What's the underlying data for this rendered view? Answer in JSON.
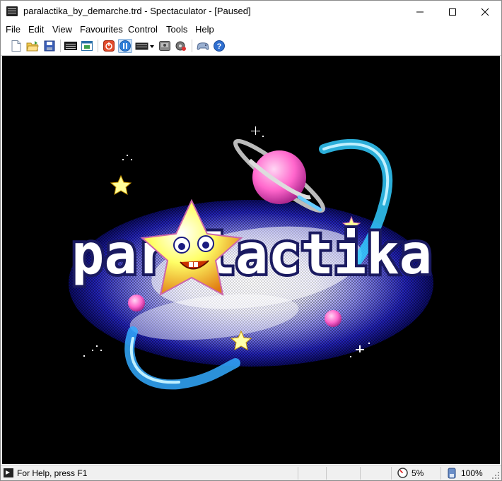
{
  "window": {
    "title": "paralactika_by_demarche.trd - Spectaculator - [Paused]",
    "minimize_icon": "minimize-icon",
    "maximize_icon": "maximize-icon",
    "close_icon": "close-icon"
  },
  "menu": [
    "File",
    "Edit",
    "View",
    "Favourites",
    "Control",
    "Tools",
    "Help"
  ],
  "toolbar": {
    "buttons": [
      "new-icon",
      "open-icon",
      "save-icon",
      "keyboard-icon",
      "window-icon",
      "power-icon",
      "pause-icon",
      "joystick-keyboard-icon",
      "disk-icon",
      "tape-icon",
      "controller-icon",
      "help-icon"
    ]
  },
  "screen": {
    "logo_text": "paralactika",
    "colors": {
      "background": "#000000",
      "galaxy_inner": "#e8e8ff",
      "galaxy_outer": "#1a1aa8",
      "planet": "#ff66cc",
      "star": "#ffff66",
      "comet": "#33ccff"
    }
  },
  "status": {
    "help_text": "For Help, press F1",
    "speed": "5%",
    "volume": "100%"
  }
}
